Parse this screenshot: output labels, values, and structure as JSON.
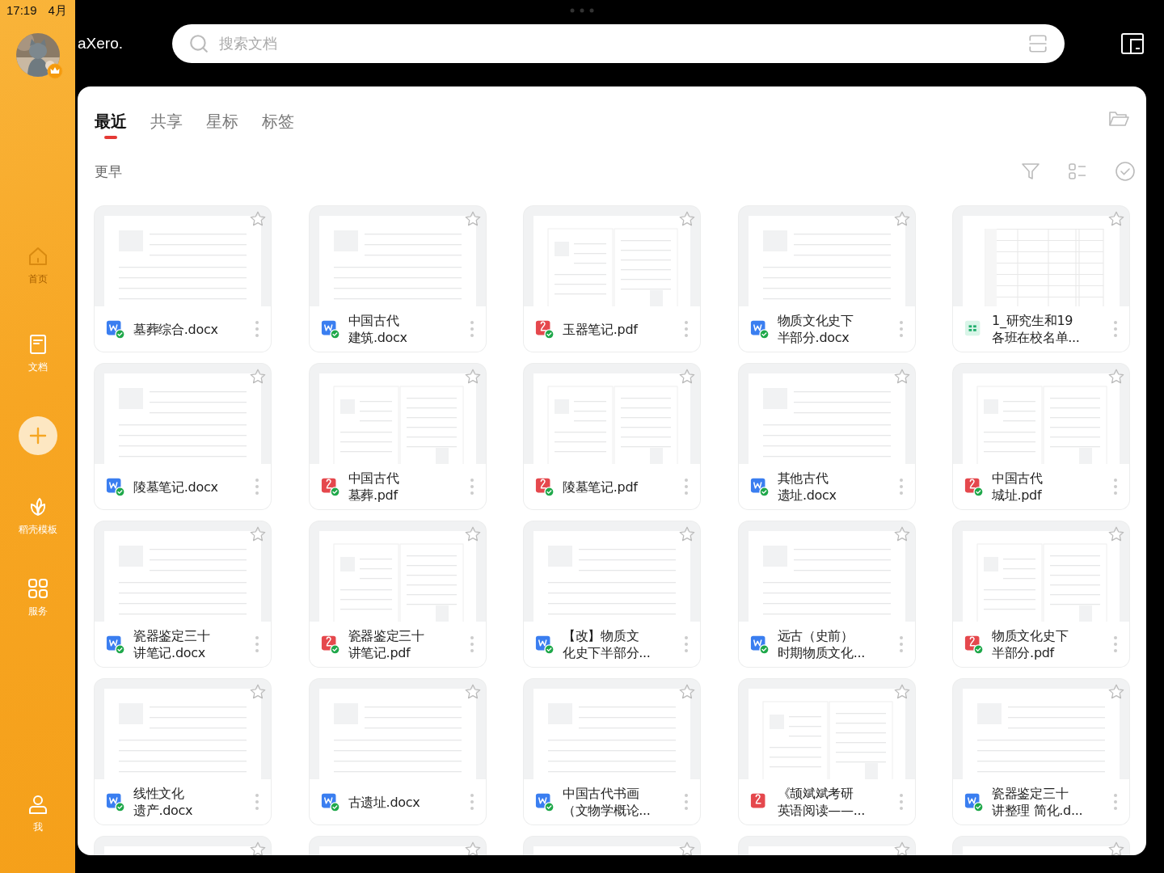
{
  "status_bar": {
    "time": "17:19",
    "date": "4月"
  },
  "user": {
    "name": "aXero.",
    "vip": true
  },
  "search": {
    "placeholder": "搜索文档"
  },
  "nav": [
    {
      "kind": "home",
      "label": "首页",
      "dimmed": true
    },
    {
      "kind": "doc",
      "label": "文档",
      "dimmed": false
    },
    {
      "kind": "add"
    },
    {
      "kind": "leaf",
      "label": "稻壳模板",
      "dimmed": false
    },
    {
      "kind": "grid",
      "label": "服务",
      "dimmed": false
    },
    {
      "kind": "user",
      "label": "我",
      "dimmed": false
    }
  ],
  "tabs": [
    {
      "label": "最近",
      "selected": true
    },
    {
      "label": "共享",
      "selected": false
    },
    {
      "label": "星标",
      "selected": false
    },
    {
      "label": "标签",
      "selected": false
    }
  ],
  "section": "更早",
  "files": [
    {
      "name_lines": [
        "墓葬综合.docx"
      ],
      "kind": "word",
      "synced": true,
      "starred": false
    },
    {
      "name_lines": [
        "中国古代",
        "建筑.docx"
      ],
      "kind": "word",
      "synced": true,
      "starred": false
    },
    {
      "name_lines": [
        "玉器笔记.pdf"
      ],
      "kind": "pdf",
      "synced": true,
      "starred": false
    },
    {
      "name_lines": [
        "物质文化史下",
        "半部分.docx"
      ],
      "kind": "word",
      "synced": true,
      "starred": false
    },
    {
      "name_lines": [
        "1_研究生和19",
        "各班在校名单..."
      ],
      "kind": "sheet",
      "synced": false,
      "starred": false
    },
    {
      "name_lines": [
        "陵墓笔记.docx"
      ],
      "kind": "word",
      "synced": true,
      "starred": false
    },
    {
      "name_lines": [
        "中国古代",
        "墓葬.pdf"
      ],
      "kind": "pdf",
      "synced": true,
      "starred": false
    },
    {
      "name_lines": [
        "陵墓笔记.pdf"
      ],
      "kind": "pdf",
      "synced": true,
      "starred": false
    },
    {
      "name_lines": [
        "其他古代",
        "遗址.docx"
      ],
      "kind": "word",
      "synced": true,
      "starred": false
    },
    {
      "name_lines": [
        "中国古代",
        "城址.pdf"
      ],
      "kind": "pdf",
      "synced": true,
      "starred": false
    },
    {
      "name_lines": [
        "瓷器鉴定三十",
        "讲笔记.docx"
      ],
      "kind": "word",
      "synced": true,
      "starred": false
    },
    {
      "name_lines": [
        "瓷器鉴定三十",
        "讲笔记.pdf"
      ],
      "kind": "pdf",
      "synced": true,
      "starred": false
    },
    {
      "name_lines": [
        "【改】物质文",
        "化史下半部分..."
      ],
      "kind": "word",
      "synced": true,
      "starred": false
    },
    {
      "name_lines": [
        "远古（史前）",
        "时期物质文化..."
      ],
      "kind": "word",
      "synced": true,
      "starred": false
    },
    {
      "name_lines": [
        "物质文化史下",
        "半部分.pdf"
      ],
      "kind": "pdf",
      "synced": true,
      "starred": false
    },
    {
      "name_lines": [
        "线性文化",
        "遗产.docx"
      ],
      "kind": "word",
      "synced": true,
      "starred": false
    },
    {
      "name_lines": [
        "古遗址.docx"
      ],
      "kind": "word",
      "synced": true,
      "starred": false
    },
    {
      "name_lines": [
        "中国古代书画",
        "（文物学概论..."
      ],
      "kind": "word",
      "synced": true,
      "starred": false
    },
    {
      "name_lines": [
        "《颉斌斌考研",
        "英语阅读——..."
      ],
      "kind": "pdf",
      "synced": false,
      "starred": false
    },
    {
      "name_lines": [
        "瓷器鉴定三十",
        "讲整理 简化.d..."
      ],
      "kind": "word",
      "synced": true,
      "starred": false
    }
  ],
  "partial_cards": [
    {
      "starred": false
    },
    {
      "starred": false
    },
    {
      "starred": false
    },
    {
      "starred": false
    },
    {
      "starred": false
    }
  ]
}
